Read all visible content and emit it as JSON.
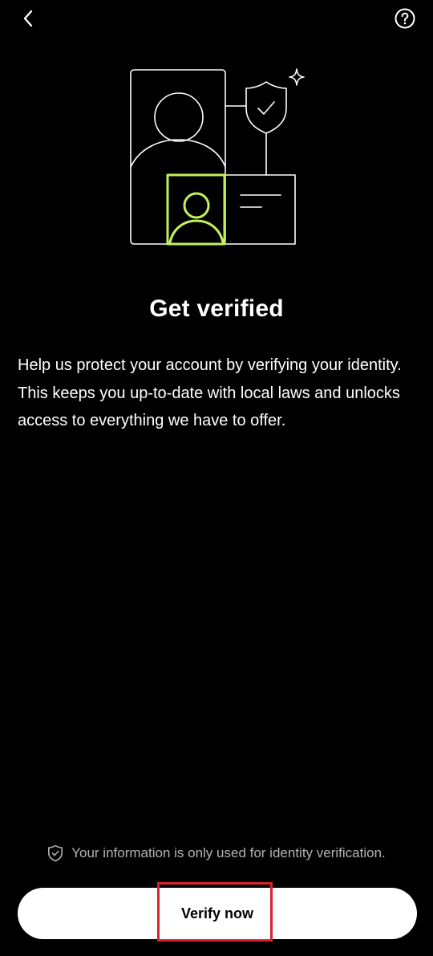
{
  "header": {
    "back_icon": "chevron-left-icon",
    "help_icon": "question-circle-icon"
  },
  "illustration": {
    "name": "identity-verification-illustration",
    "accent_color": "#c5f15b",
    "line_color": "#ffffff"
  },
  "main": {
    "title": "Get verified",
    "description": "Help us protect your account by verifying your identity. This keeps you up-to-date with local laws and unlocks access to everything we have to offer."
  },
  "footer": {
    "privacy_icon": "shield-check-icon",
    "privacy_text": "Your information is only used for identity verification.",
    "verify_button_label": "Verify now"
  },
  "colors": {
    "background": "#000000",
    "button_background": "#ffffff",
    "button_text": "#000000",
    "highlight": "#d9232f",
    "muted_text": "#b3b3b3"
  }
}
